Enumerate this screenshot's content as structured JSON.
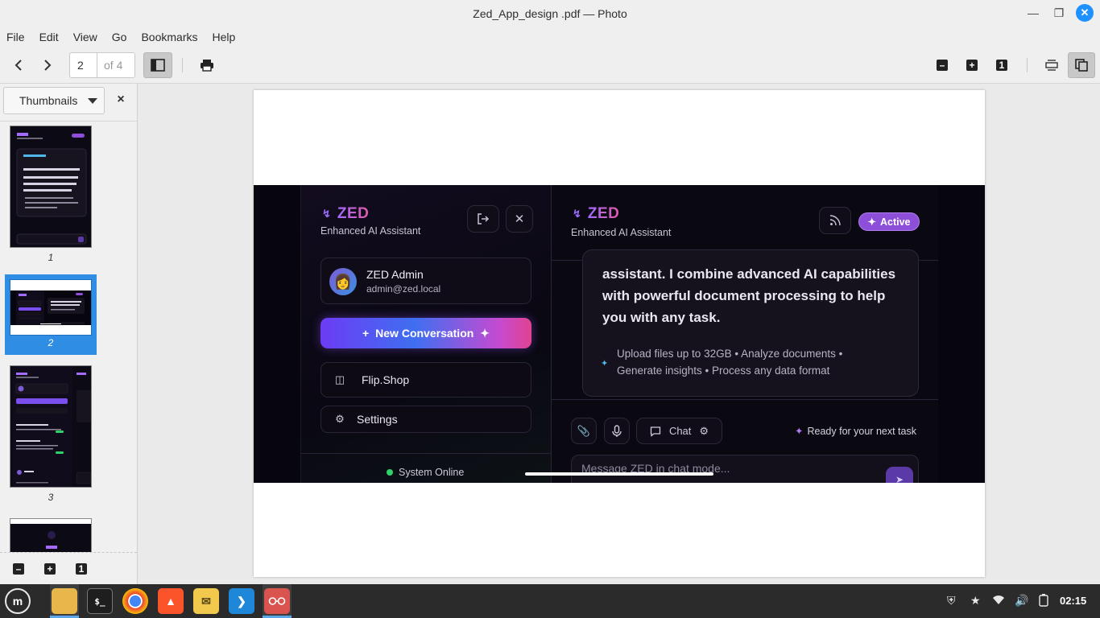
{
  "window": {
    "title": "Zed_App_design .pdf — Photo",
    "controls": [
      "minimize",
      "maximize",
      "close"
    ]
  },
  "menu": [
    "File",
    "Edit",
    "View",
    "Go",
    "Bookmarks",
    "Help"
  ],
  "toolbar": {
    "current_page": "2",
    "page_total": "of 4",
    "zoom_in": "+",
    "zoom_reset": "1"
  },
  "sidebar": {
    "mode": "Thumbnails",
    "close": "×",
    "thumbnails": [
      {
        "label": "1"
      },
      {
        "label": "2"
      },
      {
        "label": "3"
      }
    ],
    "zoom_reset": "1"
  },
  "document": {
    "brand": "ZED",
    "subtitle": "Enhanced AI Assistant",
    "user_name": "ZED Admin",
    "user_email": "admin@zed.local",
    "new_conversation": "New Conversation",
    "menu_items": [
      "Flip.Shop",
      "Settings"
    ],
    "system_status": "System Online",
    "active_badge": "Active",
    "message_lines": [
      "assistant. I combine advanced AI capabilities",
      "with powerful document processing to help",
      "you with any task."
    ],
    "message_meta": "Upload files up to 32GB • Analyze documents • Generate insights • Process any data format",
    "chat_mode": "Chat",
    "ready_text": "Ready for your next task",
    "input_placeholder": "Message ZED in chat mode..."
  },
  "taskbar": {
    "apps": [
      "menu-icon",
      "files-icon",
      "terminal-icon",
      "chrome-icon",
      "brave-icon",
      "mail-icon",
      "vscode-icon",
      "document-viewer-icon"
    ],
    "clock": "02:15"
  },
  "colors": {
    "accent": "#2f8de4",
    "brand_purple": "#8d4fd9",
    "online_green": "#2fd26a"
  }
}
